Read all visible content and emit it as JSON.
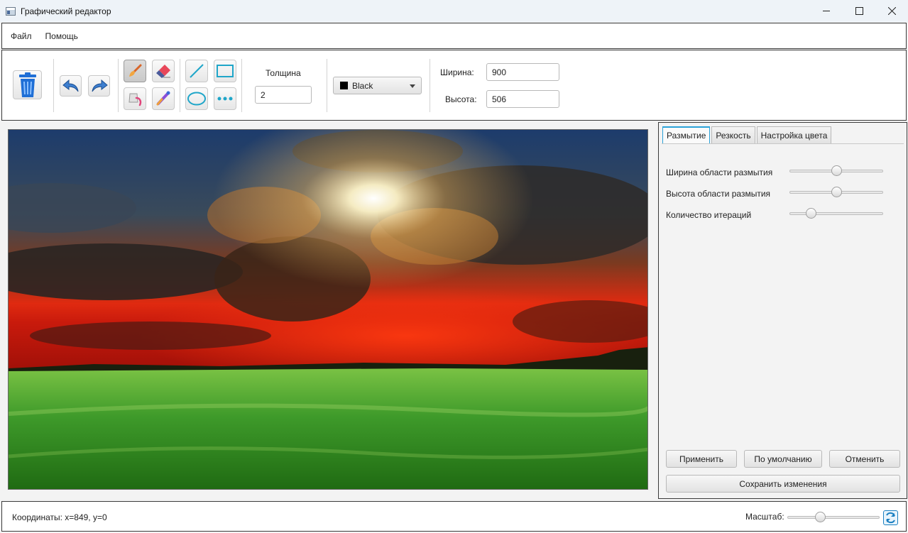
{
  "window": {
    "title": "Графический редактор",
    "minimize_glyph": "—",
    "maximize_glyph": "☐",
    "close_glyph": "✕"
  },
  "menu": {
    "items": [
      "Файл",
      "Помощь"
    ]
  },
  "toolbar": {
    "tools": [
      {
        "name": "brush",
        "icon": "brush-icon",
        "selected": true
      },
      {
        "name": "eraser",
        "icon": "eraser-icon",
        "selected": false
      },
      {
        "name": "fill",
        "icon": "fill-bucket-icon",
        "selected": false
      },
      {
        "name": "eyedropper",
        "icon": "eyedropper-icon",
        "selected": false
      },
      {
        "name": "line",
        "icon": "line-icon",
        "selected": false
      },
      {
        "name": "rectangle",
        "icon": "rectangle-icon",
        "selected": false
      },
      {
        "name": "ellipse",
        "icon": "ellipse-icon",
        "selected": false
      },
      {
        "name": "dots",
        "icon": "dotted-line-icon",
        "selected": false
      }
    ],
    "thickness_label": "Толщина",
    "thickness_value": "2",
    "color_value": "Black",
    "color_hex": "#000000",
    "width_label": "Ширина:",
    "width_value": "900",
    "height_label": "Высота:",
    "height_value": "506"
  },
  "side_panel": {
    "tabs": [
      {
        "label": "Размытие",
        "active": true
      },
      {
        "label": "Резкость",
        "active": false
      },
      {
        "label": "Настройка цвета",
        "active": false
      }
    ],
    "sliders": [
      {
        "label": "Ширина области размытия",
        "value": 0.5
      },
      {
        "label": "Высота области размытия",
        "value": 0.5
      },
      {
        "label": "Количество итераций",
        "value": 0.23
      }
    ],
    "apply_label": "Применить",
    "default_label": "По умолчанию",
    "cancel_label": "Отменить",
    "save_label": "Сохранить изменения"
  },
  "statusbar": {
    "coordinates": "Координаты: x=849, y=0",
    "zoom_label": "Масштаб:",
    "zoom_value": 0.35
  },
  "colors": {
    "accent": "#2aa2d8",
    "tool_cyan": "#1fa6c9",
    "trash_blue": "#1f6fd6"
  }
}
